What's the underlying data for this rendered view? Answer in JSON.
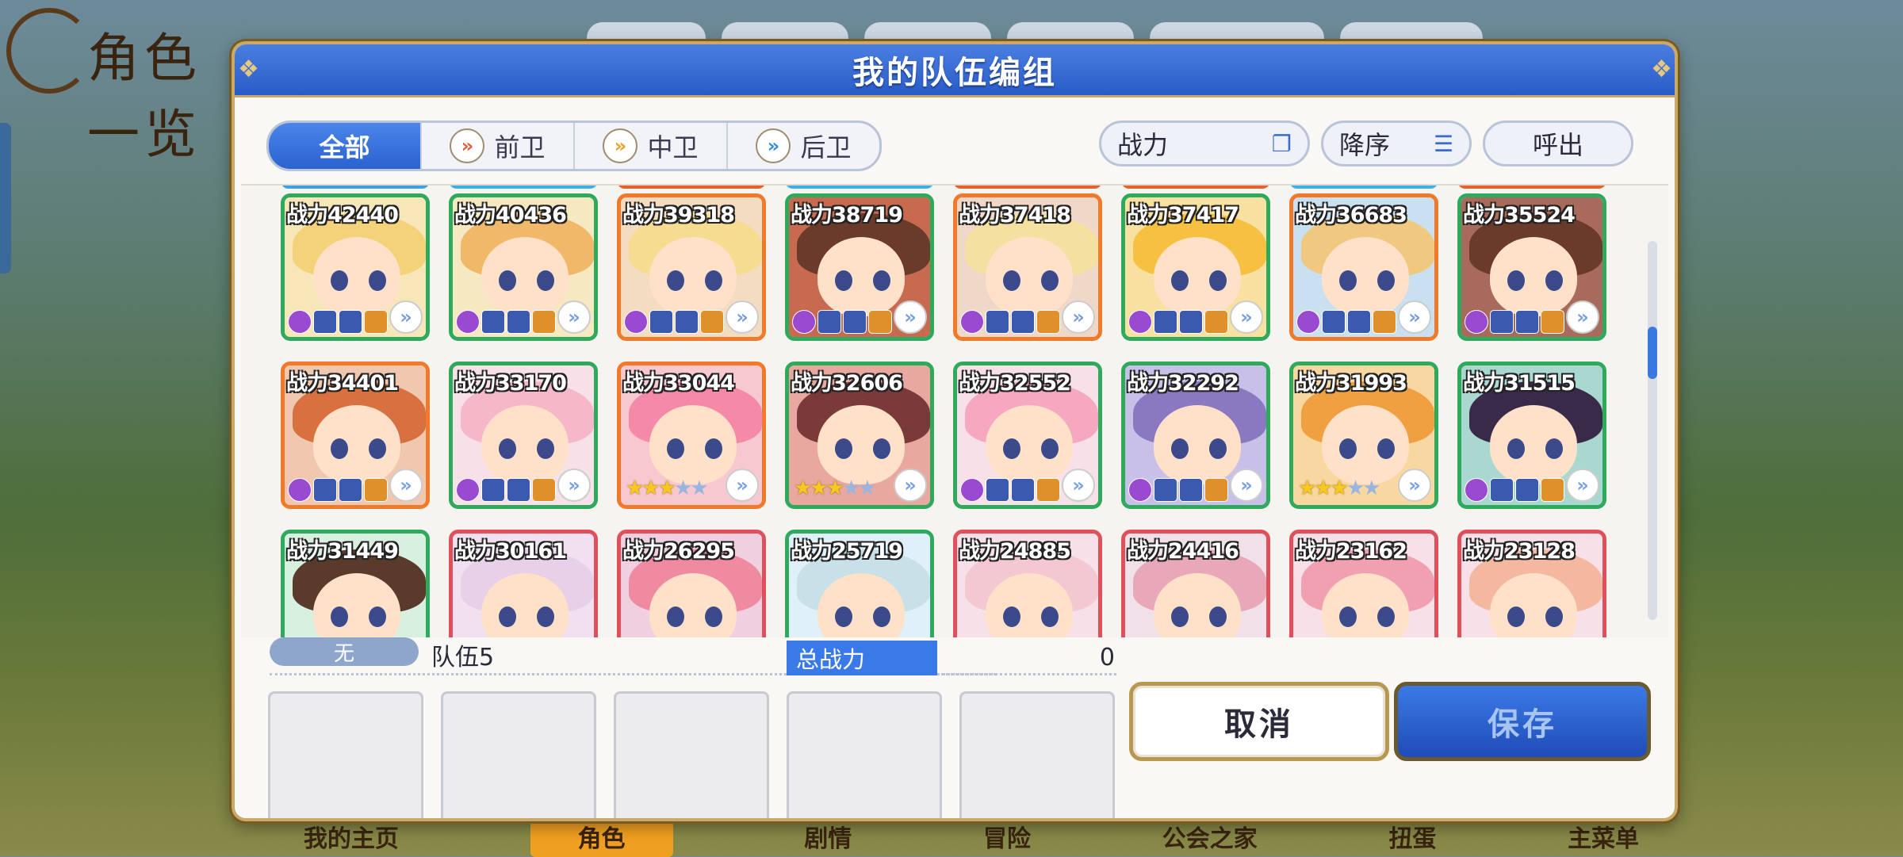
{
  "background": {
    "title": "角色一览",
    "nav": [
      "我的主页",
      "角色",
      "剧情",
      "冒险",
      "公会之家",
      "扭蛋",
      "主菜单"
    ]
  },
  "dialog": {
    "title": "我的队伍编组",
    "tabs": [
      {
        "label": "全部",
        "active": true
      },
      {
        "label": "前卫",
        "icon": "vanguard-icon"
      },
      {
        "label": "中卫",
        "icon": "midguard-icon"
      },
      {
        "label": "后卫",
        "icon": "rearguard-icon"
      }
    ],
    "sort_field": "战力",
    "sort_order": "降序",
    "call_button": "呼出",
    "rows": [
      [
        {
          "power": "战力42440",
          "frame": "green"
        },
        {
          "power": "战力40436",
          "frame": "green"
        },
        {
          "power": "战力39318",
          "frame": "orange"
        },
        {
          "power": "战力38719",
          "frame": "green"
        },
        {
          "power": "战力37418",
          "frame": "orange"
        },
        {
          "power": "战力37417",
          "frame": "green"
        },
        {
          "power": "战力36683",
          "frame": "orange"
        },
        {
          "power": "战力35524",
          "frame": "green"
        }
      ],
      [
        {
          "power": "战力34401",
          "frame": "orange"
        },
        {
          "power": "战力33170",
          "frame": "green"
        },
        {
          "power": "战力33044",
          "frame": "orange",
          "stars": 3
        },
        {
          "power": "战力32606",
          "frame": "green",
          "stars": 3
        },
        {
          "power": "战力32552",
          "frame": "green"
        },
        {
          "power": "战力32292",
          "frame": "green"
        },
        {
          "power": "战力31993",
          "frame": "green",
          "stars": 3
        },
        {
          "power": "战力31515",
          "frame": "green"
        }
      ],
      [
        {
          "power": "战力31449",
          "frame": "green"
        },
        {
          "power": "战力30161",
          "frame": "red"
        },
        {
          "power": "战力26295",
          "frame": "red"
        },
        {
          "power": "战力25719",
          "frame": "green"
        },
        {
          "power": "战力24885",
          "frame": "red"
        },
        {
          "power": "战力24416",
          "frame": "red"
        },
        {
          "power": "战力23162",
          "frame": "red"
        },
        {
          "power": "战力23128",
          "frame": "red"
        }
      ]
    ],
    "team": {
      "badge": "无",
      "name": "队伍5",
      "total_power_label": "总战力",
      "total_power_value": "0",
      "slots": 5
    },
    "cancel_button": "取消",
    "save_button": "保存"
  }
}
